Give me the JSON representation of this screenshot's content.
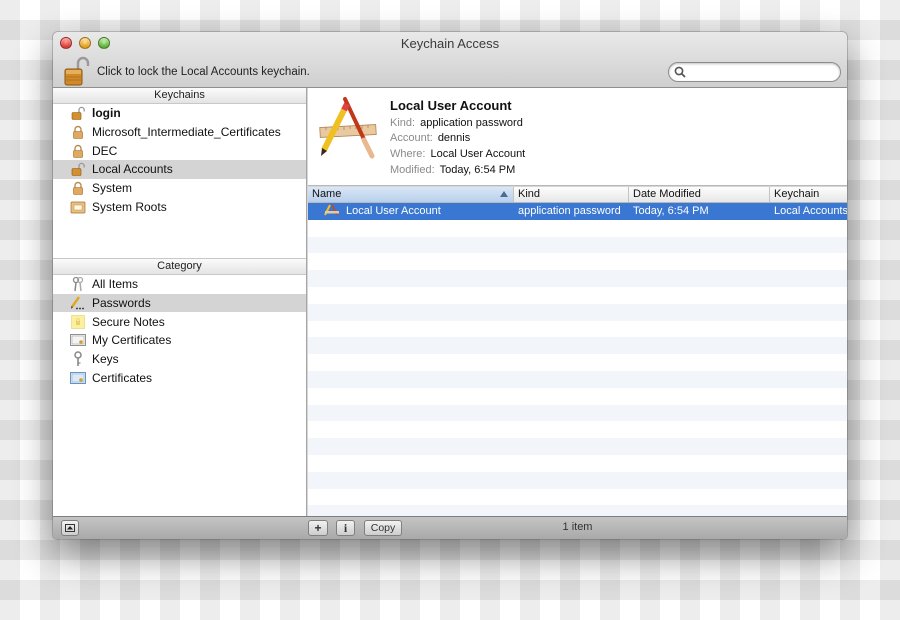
{
  "window": {
    "title": "Keychain Access",
    "lock_message": "Click to lock the Local Accounts keychain.",
    "search": {
      "placeholder": "",
      "value": ""
    }
  },
  "sidebar": {
    "keychains_header": "Keychains",
    "keychains": [
      {
        "label": "login",
        "icon": "unlocked-padlock-icon",
        "bold": true,
        "selected": false
      },
      {
        "label": "Microsoft_Intermediate_Certificates",
        "icon": "locked-padlock-icon",
        "bold": false,
        "selected": false
      },
      {
        "label": "DEC",
        "icon": "locked-padlock-icon",
        "bold": false,
        "selected": false
      },
      {
        "label": "Local Accounts",
        "icon": "unlocked-padlock-icon",
        "bold": false,
        "selected": true
      },
      {
        "label": "System",
        "icon": "locked-padlock-icon",
        "bold": false,
        "selected": false
      },
      {
        "label": "System Roots",
        "icon": "certificate-folder-icon",
        "bold": false,
        "selected": false
      }
    ],
    "category_header": "Category",
    "categories": [
      {
        "label": "All Items",
        "icon": "keys-icon",
        "selected": false
      },
      {
        "label": "Passwords",
        "icon": "password-pencil-icon",
        "selected": true
      },
      {
        "label": "Secure Notes",
        "icon": "secure-note-icon",
        "selected": false
      },
      {
        "label": "My Certificates",
        "icon": "my-certificate-icon",
        "selected": false
      },
      {
        "label": "Keys",
        "icon": "key-icon",
        "selected": false
      },
      {
        "label": "Certificates",
        "icon": "certificate-icon",
        "selected": false
      }
    ]
  },
  "detail": {
    "name": "Local User Account",
    "fields": [
      {
        "key": "Kind:",
        "value": "application password"
      },
      {
        "key": "Account:",
        "value": "dennis"
      },
      {
        "key": "Where:",
        "value": "Local User Account"
      },
      {
        "key": "Modified:",
        "value": "Today, 6:54 PM"
      }
    ]
  },
  "table": {
    "columns": [
      "Name",
      "Kind",
      "Date Modified",
      "Keychain"
    ],
    "sorted_column": "Name",
    "sort_direction": "ascending",
    "rows": [
      {
        "name": "Local User Account",
        "kind": "application password",
        "date_modified": "Today, 6:54 PM",
        "keychain": "Local Accounts",
        "selected": true
      }
    ]
  },
  "bottombar": {
    "add_label": "+",
    "info_label": "i",
    "copy_label": "Copy",
    "status": "1 item"
  },
  "colors": {
    "selection_blue": "#3a77d2",
    "sidebar_selection": "#d4d4d4",
    "stripe": "#f2f5fa"
  }
}
